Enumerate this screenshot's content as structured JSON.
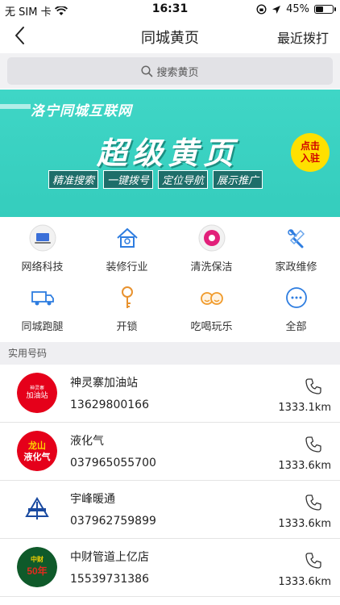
{
  "status_bar": {
    "carrier": "无 SIM 卡",
    "time": "16:31",
    "battery": "45%",
    "battery_level": 0.45
  },
  "nav": {
    "title": "同城黄页",
    "right_action": "最近拨打"
  },
  "search": {
    "placeholder": "搜索黄页"
  },
  "banner": {
    "top_text": "洛宁同城互联网",
    "main_text": "超级黄页",
    "tags": [
      "精准搜索",
      "一键拨号",
      "定位导航",
      "展示推广"
    ],
    "cta_line1": "点击",
    "cta_line2": "入驻"
  },
  "categories": [
    {
      "label": "网络科技",
      "icon": "laptop-icon"
    },
    {
      "label": "装修行业",
      "icon": "house-icon"
    },
    {
      "label": "清洗保洁",
      "icon": "cleaning-icon"
    },
    {
      "label": "家政维修",
      "icon": "wrench-icon"
    },
    {
      "label": "同城跑腿",
      "icon": "truck-icon"
    },
    {
      "label": "开锁",
      "icon": "key-icon"
    },
    {
      "label": "吃喝玩乐",
      "icon": "faces-icon"
    },
    {
      "label": "全部",
      "icon": "more-icon"
    }
  ],
  "section": {
    "title": "实用号码"
  },
  "listings": [
    {
      "name": "神灵寨加油站",
      "phone": "13629800166",
      "distance": "1333.1km",
      "logo_text": "加油站",
      "logo_sub": "神灵寨"
    },
    {
      "name": "液化气",
      "phone": "037965055700",
      "distance": "1333.6km",
      "logo_text": "龙山",
      "logo_sub": "液化气"
    },
    {
      "name": "宇峰暖通",
      "phone": "037962759899",
      "distance": "1333.6km",
      "logo_text": "",
      "logo_sub": ""
    },
    {
      "name": "中财管道上亿店",
      "phone": "15539731386",
      "distance": "1333.6km",
      "logo_text": "50年",
      "logo_sub": "中财"
    }
  ],
  "colors": {
    "banner": "#3fd6c6",
    "cta": "#ffe000",
    "accent_red": "#d10000"
  }
}
